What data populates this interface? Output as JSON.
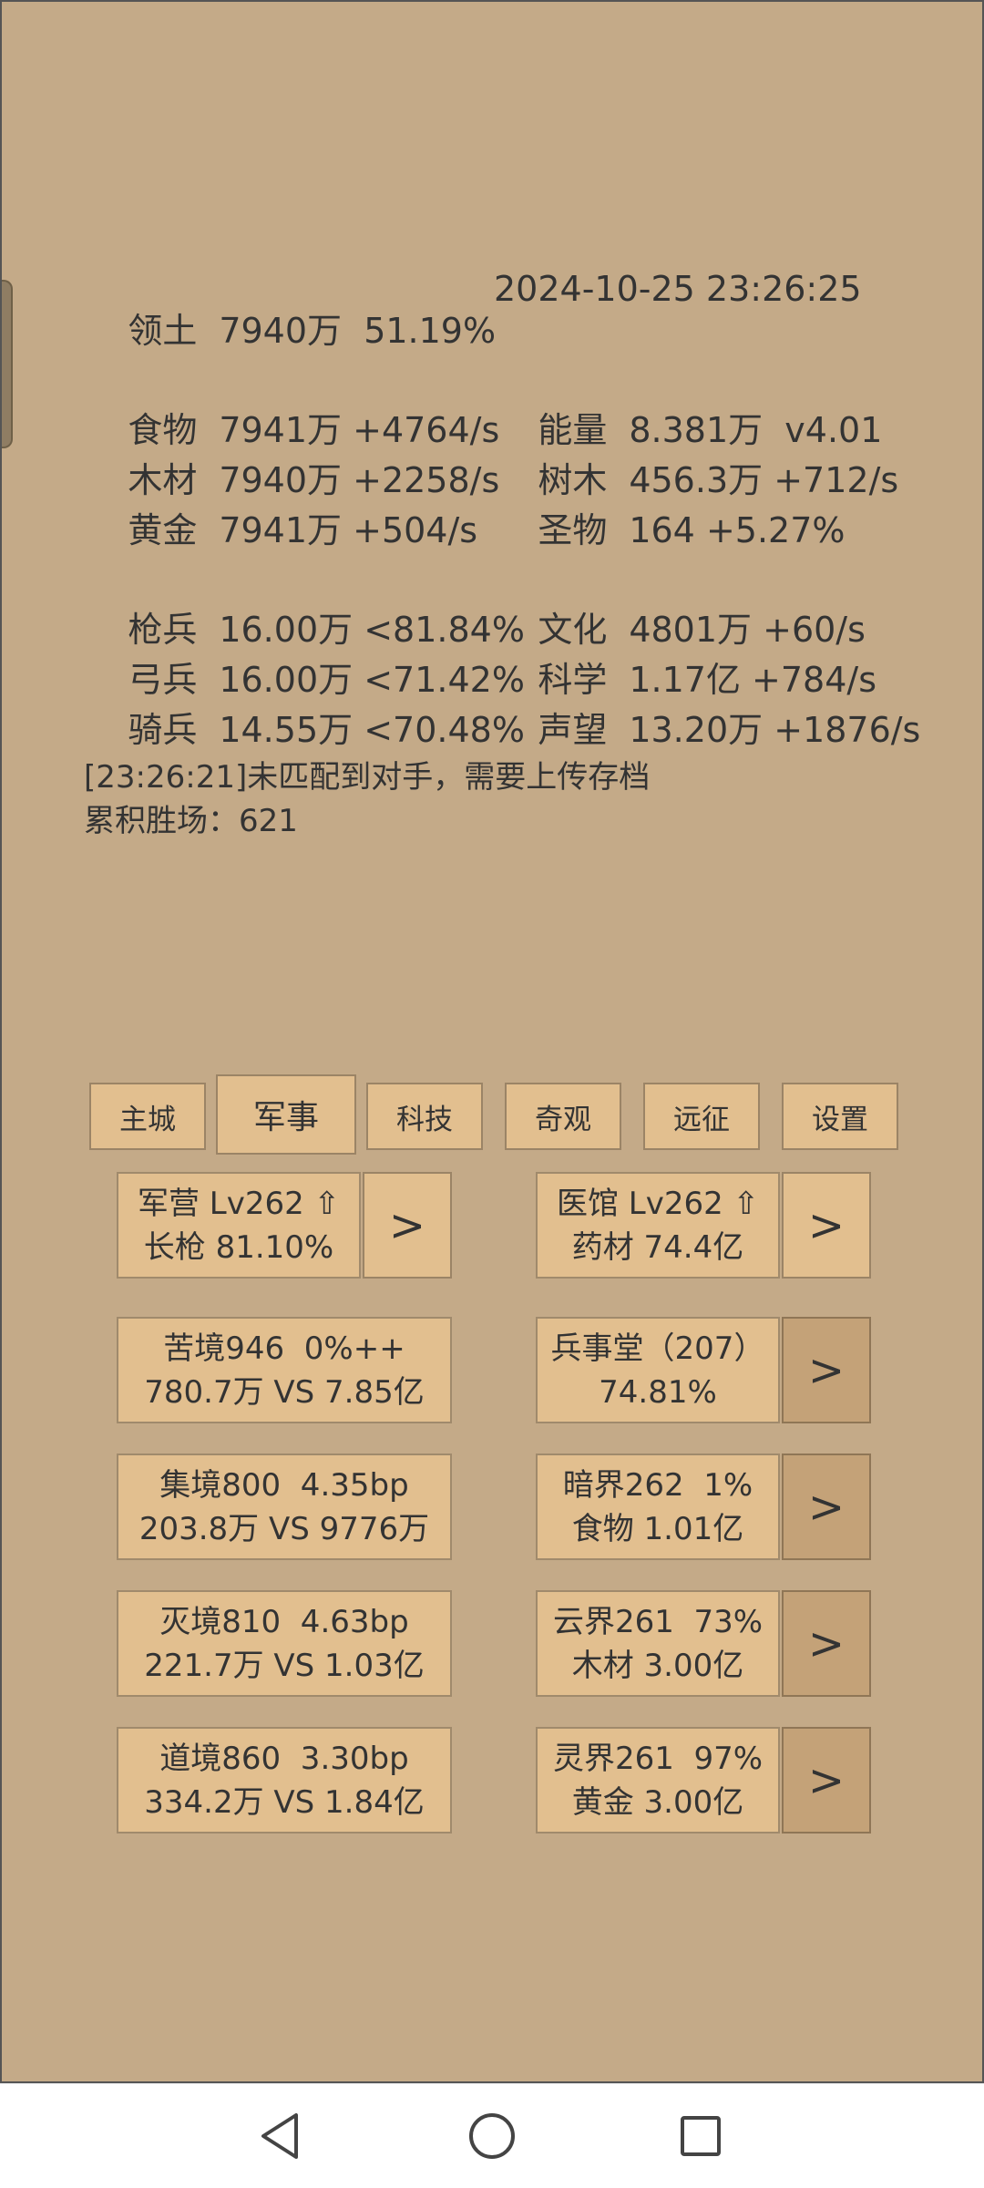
{
  "stats_left": [
    {
      "key": "领土",
      "value": "7940万  51.19%"
    }
  ],
  "datetime": "2024-10-25 23:26:25",
  "resources_left": [
    {
      "key": "食物",
      "value": "7941万 +4764/s"
    },
    {
      "key": "木材",
      "value": "7940万 +2258/s"
    },
    {
      "key": "黄金",
      "value": "7941万 +504/s"
    }
  ],
  "resources_right": [
    {
      "key": "能量",
      "value": "8.381万  v4.01"
    },
    {
      "key": "树木",
      "value": "456.3万 +712/s"
    },
    {
      "key": "圣物",
      "value": "164 +5.27%"
    }
  ],
  "troops_left": [
    {
      "key": "枪兵",
      "value": "16.00万 <81.84%"
    },
    {
      "key": "弓兵",
      "value": "16.00万 <71.42%"
    },
    {
      "key": "骑兵",
      "value": "14.55万 <70.48%"
    }
  ],
  "troops_right": [
    {
      "key": "文化",
      "value": "4801万 +60/s"
    },
    {
      "key": "科学",
      "value": "1.17亿 +784/s"
    },
    {
      "key": "声望",
      "value": "13.20万 +1876/s"
    }
  ],
  "log": {
    "line1": "[23:26:21]未匹配到对手，需要上传存档",
    "line2": "累积胜场：621"
  },
  "tabs": [
    "主城",
    "军事",
    "科技",
    "奇观",
    "远征",
    "设置"
  ],
  "active_tab": "军事",
  "cards": {
    "barracks": {
      "line1": "军营 Lv262 ⇧",
      "line2": "长枪 81.10%"
    },
    "hospital": {
      "line1": "医馆 Lv262 ⇧",
      "line2": "药材 74.4亿"
    },
    "kujing": {
      "line1": "苦境946  0%++",
      "line2": "780.7万 VS 7.85亿"
    },
    "bingshitang": {
      "line1": "兵事堂（207）",
      "line2": "74.81%"
    },
    "jijing": {
      "line1": "集境800  4.35bp",
      "line2": "203.8万 VS 9776万"
    },
    "anjie": {
      "line1": "暗界262  1%",
      "line2": "食物 1.01亿"
    },
    "miejing": {
      "line1": "灭境810  4.63bp",
      "line2": "221.7万 VS 1.03亿"
    },
    "yunjie": {
      "line1": "云界261  73%",
      "line2": "木材 3.00亿"
    },
    "daojing": {
      "line1": "道境860  3.30bp",
      "line2": "334.2万 VS 1.84亿"
    },
    "lingjie": {
      "line1": "灵界261  97%",
      "line2": "黄金 3.00亿"
    }
  },
  "arrow_label": ">",
  "colors": {
    "background": "#c4aa88",
    "card": "#e2bf8f",
    "arrow_dark": "#c4a278"
  },
  "navbar": {
    "back": "back-icon",
    "home": "home-icon",
    "recents": "recents-icon"
  }
}
